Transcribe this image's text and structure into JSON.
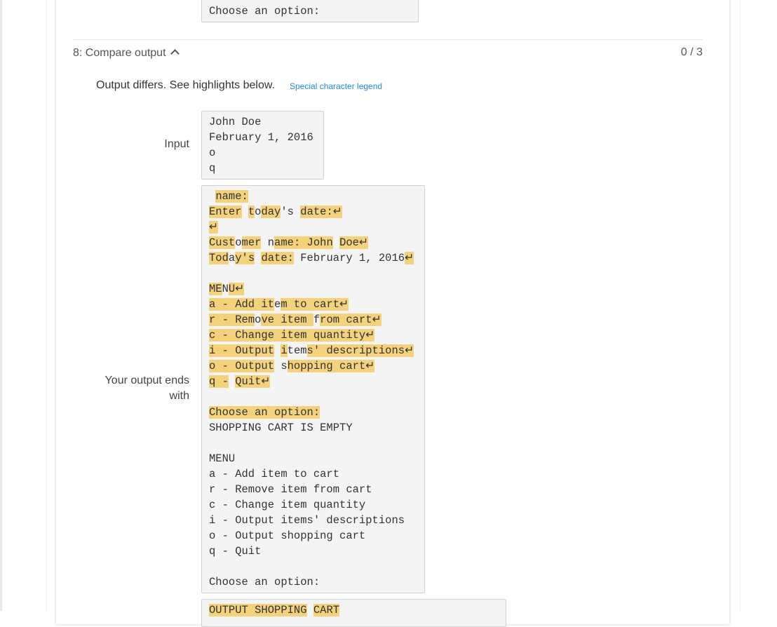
{
  "prev_box": {
    "lines": [
      "Choose an option:"
    ]
  },
  "section": {
    "title": "8: Compare output",
    "score": "0 / 3",
    "status": "Output differs. See highlights below.",
    "legend_link": "Special character legend"
  },
  "input": {
    "label": "Input",
    "lines": [
      "John Doe",
      "February 1, 2016",
      "o",
      "q"
    ]
  },
  "output": {
    "label": "Your output ends with",
    "highlight_color": "#f3d27b",
    "lines": [
      [
        [
          " ",
          0
        ],
        [
          "name:",
          1
        ]
      ],
      [
        [
          "Enter",
          1
        ],
        [
          " ",
          0
        ],
        [
          "t",
          1
        ],
        [
          "o",
          0
        ],
        [
          "day",
          1
        ],
        [
          "'s ",
          0
        ],
        [
          "date:↵",
          1
        ]
      ],
      [
        [
          "↵",
          1
        ]
      ],
      [
        [
          "Cust",
          1
        ],
        [
          "o",
          0
        ],
        [
          "mer",
          1
        ],
        [
          " n",
          0
        ],
        [
          "ame: John",
          1
        ],
        [
          " ",
          0
        ],
        [
          "Doe↵",
          1
        ]
      ],
      [
        [
          "Tod",
          1
        ],
        [
          "a",
          0
        ],
        [
          "y's",
          1
        ],
        [
          " ",
          0
        ],
        [
          "date:",
          1
        ],
        [
          " February 1, 2016",
          0
        ],
        [
          "↵",
          1
        ]
      ],
      [],
      [
        [
          "ME",
          1
        ],
        [
          "N",
          0
        ],
        [
          "U↵",
          1
        ]
      ],
      [
        [
          "a - Add it",
          1
        ],
        [
          "e",
          0
        ],
        [
          "m to cart↵",
          1
        ]
      ],
      [
        [
          "r - ",
          1
        ],
        [
          "Rem",
          1
        ],
        [
          "o",
          0
        ],
        [
          "ve item ",
          1
        ],
        [
          "f",
          0
        ],
        [
          "rom cart↵",
          1
        ]
      ],
      [
        [
          "c - Change item quantity↵",
          1
        ]
      ],
      [
        [
          "i - Output",
          1
        ],
        [
          " ",
          0
        ],
        [
          "i",
          1
        ],
        [
          "tem",
          0
        ],
        [
          "s' descriptions↵",
          1
        ]
      ],
      [
        [
          "o - Output",
          1
        ],
        [
          " s",
          0
        ],
        [
          "hopping cart↵",
          1
        ]
      ],
      [
        [
          "q -",
          1
        ],
        [
          " ",
          0
        ],
        [
          "Quit↵",
          1
        ]
      ],
      [],
      [
        [
          "Choose an option:",
          1
        ]
      ],
      [
        [
          "SHOPPING CART IS EMPTY",
          0
        ]
      ],
      [],
      [
        [
          "MENU",
          0
        ]
      ],
      [
        [
          "a - Add item to cart",
          0
        ]
      ],
      [
        [
          "r - Remove item from cart",
          0
        ]
      ],
      [
        [
          "c - Change item quantity",
          0
        ]
      ],
      [
        [
          "i - Output items' descriptions",
          0
        ]
      ],
      [
        [
          "o - Output shopping cart",
          0
        ]
      ],
      [
        [
          "q - Quit",
          0
        ]
      ],
      [],
      [
        [
          "Choose an option:",
          0
        ]
      ]
    ]
  },
  "expected": {
    "lines": [
      [
        [
          "OUTPUT SHOPPING",
          1
        ],
        [
          " ",
          0
        ],
        [
          "CART",
          1
        ]
      ]
    ]
  }
}
